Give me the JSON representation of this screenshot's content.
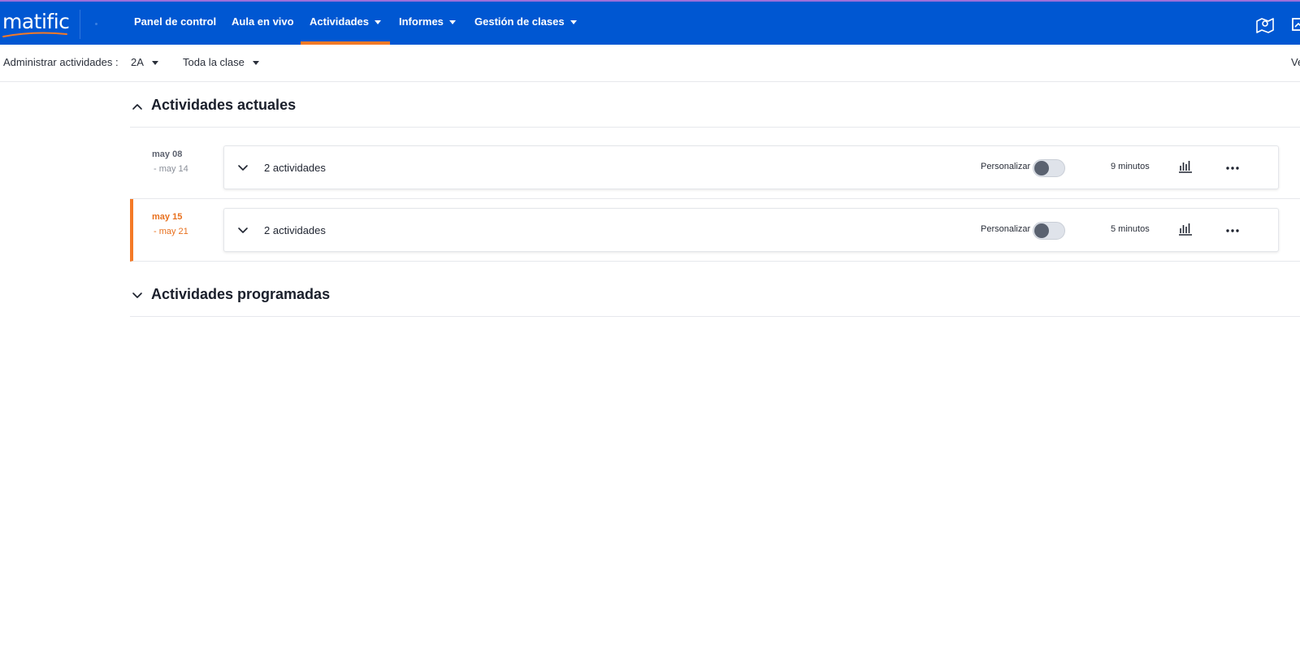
{
  "brand": {
    "name": "matific"
  },
  "nav": {
    "items": [
      {
        "label": "Panel de control",
        "has_menu": false
      },
      {
        "label": "Aula en vivo",
        "has_menu": false
      },
      {
        "label": "Actividades",
        "has_menu": true,
        "active": true
      },
      {
        "label": "Informes",
        "has_menu": true
      },
      {
        "label": "Gestión de clases",
        "has_menu": true
      }
    ],
    "right_icons": [
      "map-icon",
      "presentation-icon"
    ]
  },
  "subheader": {
    "label": "Administrar actividades :",
    "class_select": "2A",
    "group_select": "Toda la clase",
    "right_text": "Ve"
  },
  "sections": {
    "current": {
      "title": "Actividades actuales",
      "expanded": true,
      "rows": [
        {
          "date_start": "may 08",
          "date_end": "- may 14",
          "count_label": "2 actividades",
          "personalize_label": "Personalizar",
          "personalize_on": false,
          "duration": "9 minutos",
          "highlighted": false
        },
        {
          "date_start": "may 15",
          "date_end": "- may 21",
          "count_label": "2 actividades",
          "personalize_label": "Personalizar",
          "personalize_on": false,
          "duration": "5 minutos",
          "highlighted": true
        }
      ]
    },
    "scheduled": {
      "title": "Actividades programadas",
      "expanded": false
    }
  },
  "colors": {
    "nav_bg": "#0057d2",
    "accent": "#f47a27",
    "text": "#1f2430"
  }
}
